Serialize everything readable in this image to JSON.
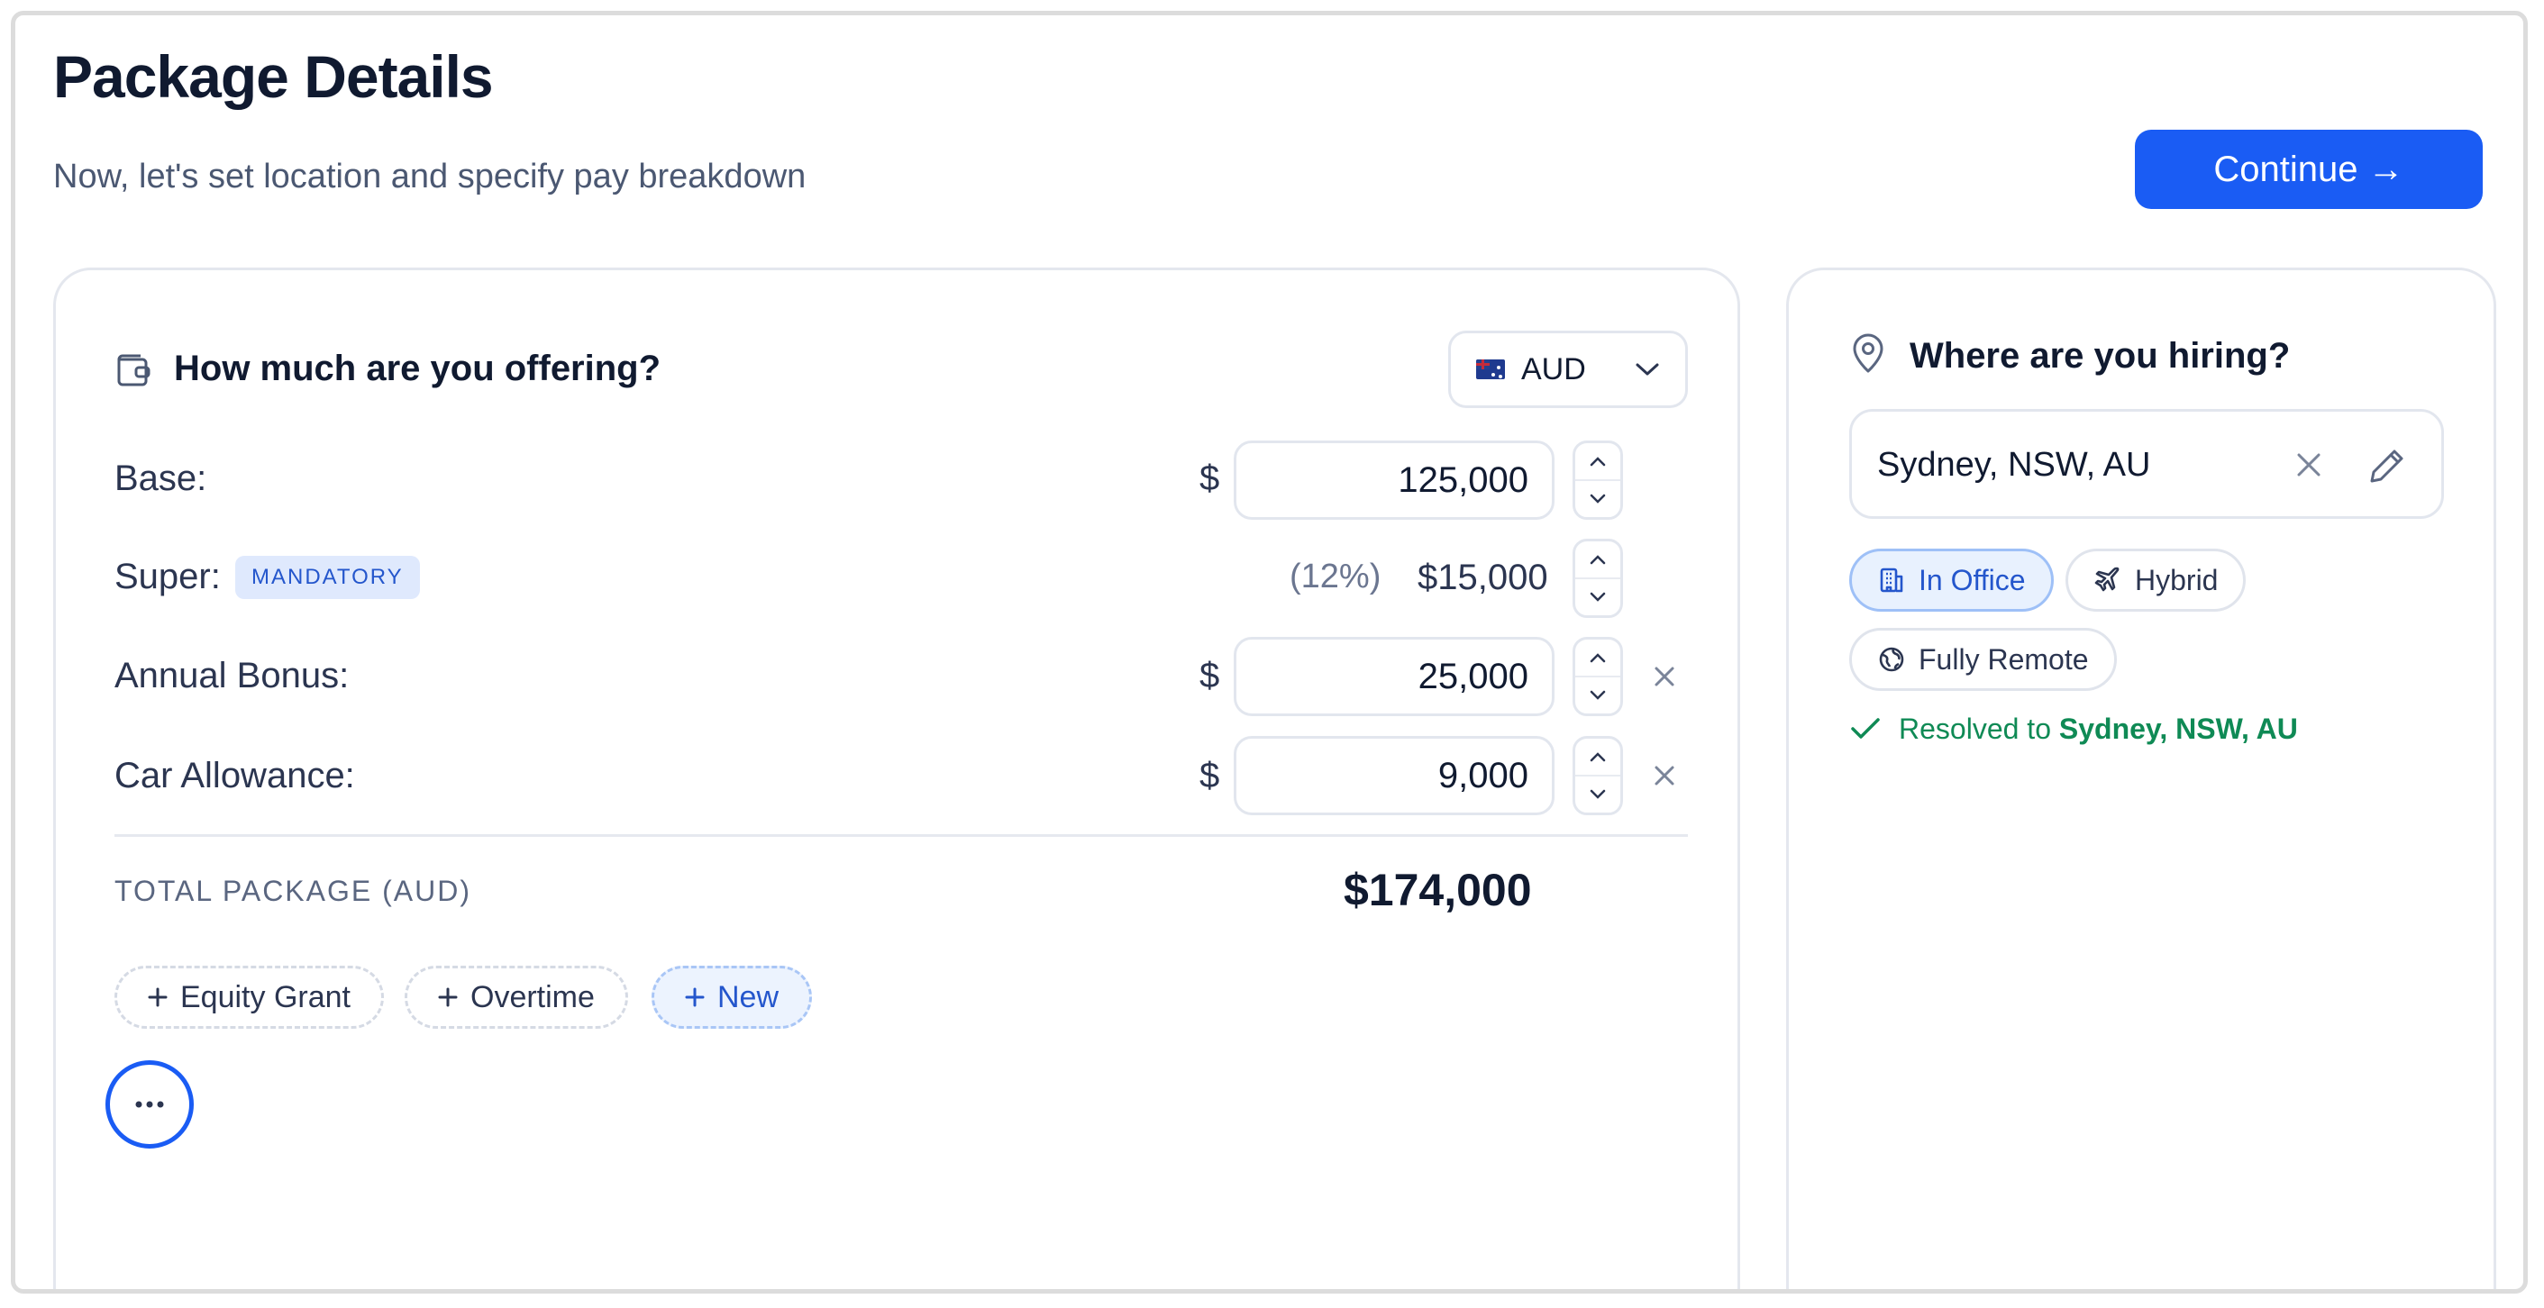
{
  "header": {
    "title": "Package Details",
    "subtitle": "Now, let's set location and specify pay breakdown",
    "continue_label": "Continue →"
  },
  "offer": {
    "heading": "How much are you offering?",
    "currency": {
      "code": "AUD",
      "flag": "au-flag"
    },
    "rows": {
      "base": {
        "label": "Base:",
        "symbol": "$",
        "value": "125,000"
      },
      "super": {
        "label": "Super:",
        "badge": "MANDATORY",
        "percent": "(12%)",
        "value": "$15,000"
      },
      "bonus": {
        "label": "Annual Bonus:",
        "symbol": "$",
        "value": "25,000"
      },
      "car": {
        "label": "Car Allowance:",
        "symbol": "$",
        "value": "9,000"
      }
    },
    "total": {
      "label": "TOTAL PACKAGE (AUD)",
      "value": "$174,000"
    },
    "add_chips": {
      "equity": "Equity Grant",
      "overtime": "Overtime",
      "new": "New"
    }
  },
  "location": {
    "heading": "Where are you hiring?",
    "value": "Sydney, NSW, AU",
    "work_modes": {
      "office": "In Office",
      "hybrid": "Hybrid",
      "remote": "Fully Remote"
    },
    "active_mode": "In Office",
    "resolved_prefix": "Resolved to",
    "resolved_value": "Sydney, NSW, AU"
  },
  "colors": {
    "accent": "#1a5cf4",
    "success": "#0f8a55",
    "badge_bg": "#dfe9fd"
  }
}
